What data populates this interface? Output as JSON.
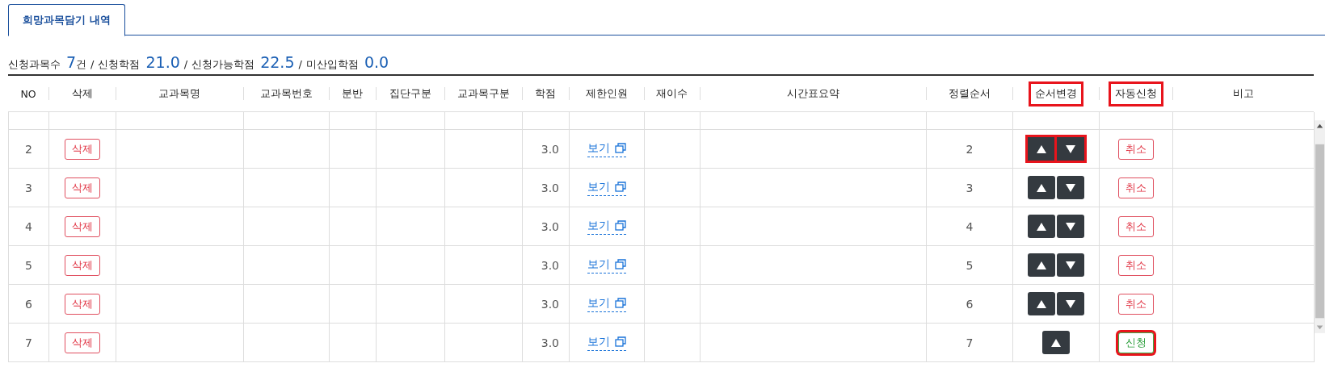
{
  "tabs": [
    {
      "label": "희망과목담기 내역",
      "selected": true
    }
  ],
  "summary": [
    {
      "label": "신청과목수",
      "value": "7",
      "unit": "건"
    },
    {
      "separator": "/",
      "label": "신청학점",
      "value": "21.0"
    },
    {
      "separator": "/",
      "label": "신청가능학점",
      "value": "22.5"
    },
    {
      "separator": "/",
      "label": "미산입학점",
      "value": "0.0"
    }
  ],
  "table": {
    "columns": [
      {
        "label": "NO",
        "highlighted": false
      },
      {
        "label": "삭제",
        "highlighted": false
      },
      {
        "label": "교과목명",
        "highlighted": false
      },
      {
        "label": "교과목번호",
        "highlighted": false
      },
      {
        "label": "분반",
        "highlighted": false
      },
      {
        "label": "집단구분",
        "highlighted": false
      },
      {
        "label": "교과목구분",
        "highlighted": false
      },
      {
        "label": "학점",
        "highlighted": false
      },
      {
        "label": "제한인원",
        "highlighted": false
      },
      {
        "label": "재이수",
        "highlighted": false
      },
      {
        "label": "시간표요약",
        "highlighted": false
      },
      {
        "label": "정렬순서",
        "highlighted": false
      },
      {
        "label": "순서변경",
        "highlighted": true
      },
      {
        "label": "자동신청",
        "highlighted": true
      },
      {
        "label": "비고",
        "highlighted": false
      }
    ],
    "rows": [
      {
        "no": "2",
        "delete": "삭제",
        "credit": "3.0",
        "limit": "보기",
        "order": "2",
        "move": [
          {
            "kind": "up",
            "highlighted": true
          },
          {
            "kind": "down",
            "highlighted": true
          }
        ],
        "auto": {
          "label": "취소",
          "kind": "cancel",
          "highlighted": false
        }
      },
      {
        "no": "3",
        "delete": "삭제",
        "credit": "3.0",
        "limit": "보기",
        "order": "3",
        "move": [
          {
            "kind": "up",
            "highlighted": false
          },
          {
            "kind": "down",
            "highlighted": false
          }
        ],
        "auto": {
          "label": "취소",
          "kind": "cancel",
          "highlighted": false
        }
      },
      {
        "no": "4",
        "delete": "삭제",
        "credit": "3.0",
        "limit": "보기",
        "order": "4",
        "move": [
          {
            "kind": "up",
            "highlighted": false
          },
          {
            "kind": "down",
            "highlighted": false
          }
        ],
        "auto": {
          "label": "취소",
          "kind": "cancel",
          "highlighted": false
        }
      },
      {
        "no": "5",
        "delete": "삭제",
        "credit": "3.0",
        "limit": "보기",
        "order": "5",
        "move": [
          {
            "kind": "up",
            "highlighted": false
          },
          {
            "kind": "down",
            "highlighted": false
          }
        ],
        "auto": {
          "label": "취소",
          "kind": "cancel",
          "highlighted": false
        }
      },
      {
        "no": "6",
        "delete": "삭제",
        "credit": "3.0",
        "limit": "보기",
        "order": "6",
        "move": [
          {
            "kind": "up",
            "highlighted": false
          },
          {
            "kind": "down",
            "highlighted": false
          }
        ],
        "auto": {
          "label": "취소",
          "kind": "cancel",
          "highlighted": false
        }
      },
      {
        "no": "7",
        "delete": "삭제",
        "credit": "3.0",
        "limit": "보기",
        "order": "7",
        "move": [
          {
            "kind": "up",
            "highlighted": false
          }
        ],
        "auto": {
          "label": "신청",
          "kind": "apply",
          "highlighted": true
        }
      }
    ]
  }
}
